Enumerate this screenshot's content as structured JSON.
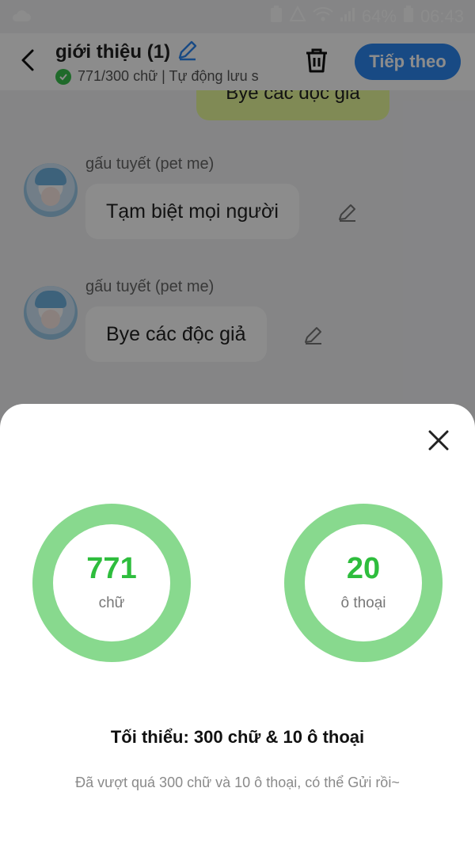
{
  "status_bar": {
    "battery": "64%",
    "time": "06:43"
  },
  "header": {
    "title": "giới thiệu (1)",
    "subtitle": "771/300 chữ | Tự động lưu s",
    "next_label": "Tiếp theo"
  },
  "chat": {
    "my_message": "Bye các độc giả",
    "messages": [
      {
        "speaker": "gấu tuyết (pet me)",
        "text": "Tạm biệt mọi người"
      },
      {
        "speaker": "gấu tuyết (pet me)",
        "text": "Bye các độc giả"
      }
    ]
  },
  "sheet": {
    "words_value": "771",
    "words_label": "chữ",
    "lines_value": "20",
    "lines_label": "ô thoại",
    "minimum": "Tối thiểu: 300 chữ & 10 ô thoại",
    "note": "Đã vượt quá 300 chữ và 10 ô thoại, có thể Gửi rồi~"
  },
  "colors": {
    "accent": "#2c87f0",
    "ring": "#88d98e",
    "value": "#2ebd3d",
    "bubble_mine": "#e9fb9b"
  }
}
